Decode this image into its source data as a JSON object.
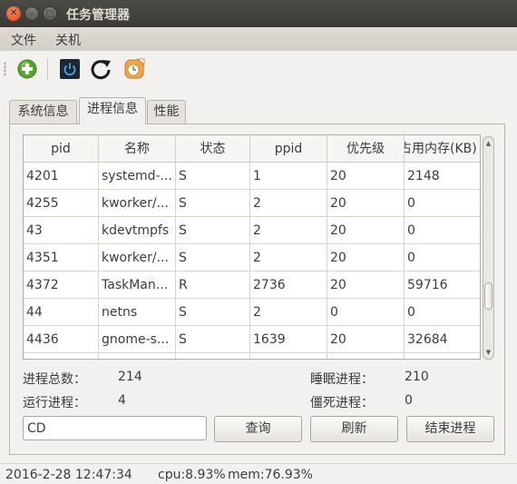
{
  "window": {
    "title": "任务管理器"
  },
  "menu": {
    "items": [
      "文件",
      "关机"
    ]
  },
  "toolbar": {
    "icons": [
      "add-icon",
      "power-icon",
      "refresh-icon",
      "clock-icon"
    ]
  },
  "tabs": [
    "系统信息",
    "进程信息",
    "性能"
  ],
  "active_tab": "进程信息",
  "table": {
    "columns": [
      "pid",
      "名称",
      "状态",
      "ppid",
      "优先级",
      "占用内存(KB)"
    ],
    "rows": [
      [
        "4201",
        "systemd-...",
        "S",
        "1",
        "20",
        "2148"
      ],
      [
        "4255",
        "kworker/...",
        "S",
        "2",
        "20",
        "0"
      ],
      [
        "43",
        "kdevtmpfs",
        "S",
        "2",
        "20",
        "0"
      ],
      [
        "4351",
        "kworker/...",
        "S",
        "2",
        "20",
        "0"
      ],
      [
        "4372",
        "TaskMan...",
        "R",
        "2736",
        "20",
        "59716"
      ],
      [
        "44",
        "netns",
        "S",
        "2",
        "0",
        "0"
      ],
      [
        "4436",
        "gnome-s...",
        "S",
        "1639",
        "20",
        "32684"
      ],
      [
        "",
        "",
        "",
        "",
        "",
        ""
      ]
    ]
  },
  "stats": {
    "total_label": "进程总数：",
    "total_value": "214",
    "sleep_label": "睡眠进程：",
    "sleep_value": "210",
    "running_label": "运行进程：",
    "running_value": "4",
    "zombie_label": "僵死进程：",
    "zombie_value": "0"
  },
  "query": {
    "value": "CD",
    "search_label": "查询",
    "refresh_label": "刷新",
    "kill_label": "结束进程"
  },
  "status": {
    "datetime": "2016-2-28 12:47:34",
    "cpu": "cpu:8.93%",
    "mem": "mem:76.93%"
  }
}
